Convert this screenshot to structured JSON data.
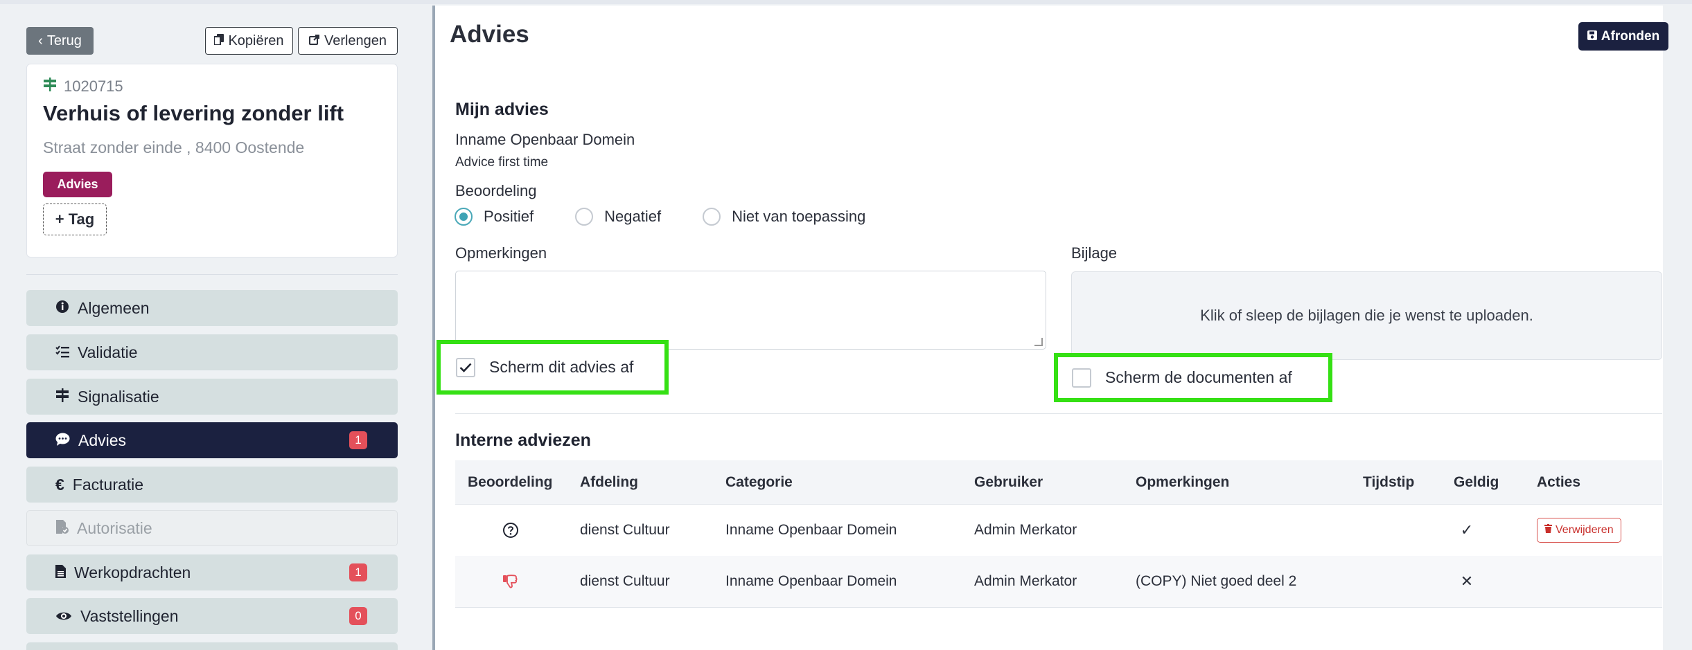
{
  "sidebar": {
    "back_label": "Terug",
    "copy_label": "Kopiëren",
    "extend_label": "Verlengen",
    "case_number": "1020715",
    "case_title": "Verhuis of levering zonder lift",
    "case_address": "Straat zonder einde , 8400 Oostende",
    "tag_badge": "Advies",
    "add_tag_label": "+ Tag",
    "nav": [
      {
        "label": "Algemeen",
        "icon": "info-icon"
      },
      {
        "label": "Validatie",
        "icon": "checklist-icon"
      },
      {
        "label": "Signalisatie",
        "icon": "signpost-icon"
      },
      {
        "label": "Advies",
        "icon": "comment-icon",
        "count": "1",
        "active": true
      },
      {
        "label": "Facturatie",
        "icon": "euro-icon"
      },
      {
        "label": "Autorisatie",
        "icon": "file-check-icon",
        "disabled": true
      },
      {
        "label": "Werkopdrachten",
        "icon": "file-icon",
        "count": "1"
      },
      {
        "label": "Vaststellingen",
        "icon": "eye-icon",
        "count": "0"
      }
    ]
  },
  "main": {
    "title": "Advies",
    "finish_label": "Afronden",
    "my_advice": {
      "heading": "Mijn advies",
      "category": "Inname Openbaar Domein",
      "subtitle": "Advice first time",
      "rating_label": "Beoordeling",
      "options": [
        "Positief",
        "Negatief",
        "Niet van toepassing"
      ],
      "selected": "Positief",
      "remarks_label": "Opmerkingen",
      "remarks_value": "",
      "attachment_label": "Bijlage",
      "dropzone_text": "Klik of sleep de bijlagen die je wenst te uploaden.",
      "shield_advice_label": "Scherm dit advies af",
      "shield_advice_checked": true,
      "shield_docs_label": "Scherm de documenten af",
      "shield_docs_checked": false
    },
    "internal": {
      "heading": "Interne adviezen",
      "columns": [
        "Beoordeling",
        "Afdeling",
        "Categorie",
        "Gebruiker",
        "Opmerkingen",
        "Tijdstip",
        "Geldig",
        "Acties"
      ],
      "rows": [
        {
          "rating_icon": "question-circle-icon",
          "department": "dienst Cultuur",
          "category": "Inname Openbaar Domein",
          "user": "Admin Merkator",
          "remarks": "",
          "time": "",
          "valid": "✓",
          "action": "Verwijderen"
        },
        {
          "rating_icon": "thumbs-down-icon",
          "department": "dienst Cultuur",
          "category": "Inname Openbaar Domein",
          "user": "Admin Merkator",
          "remarks": "(COPY) Niet goed deel 2",
          "time": "",
          "valid": "✕",
          "action": ""
        }
      ]
    }
  },
  "colors": {
    "accent_dark": "#1b2140",
    "badge": "#9a1d5c",
    "highlight": "#35e014",
    "danger": "#e4505a",
    "radio_selected": "#3da3b5"
  }
}
